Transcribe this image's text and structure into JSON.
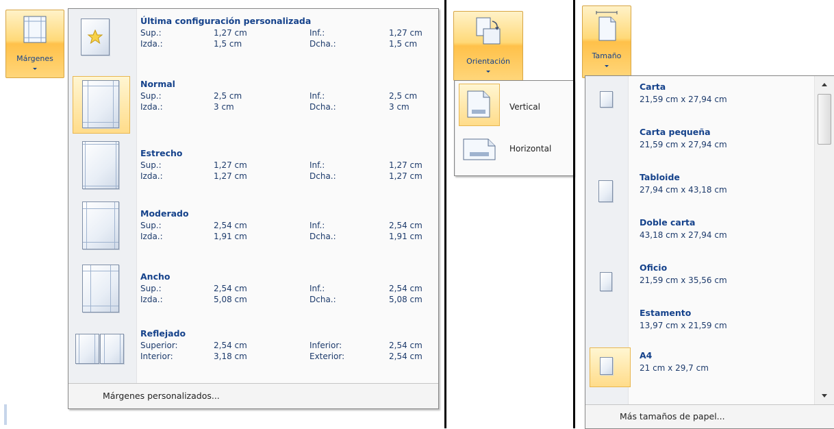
{
  "margins": {
    "button_label": "Márgenes",
    "items": [
      {
        "title": "Última configuración personalizada",
        "r1": [
          "Sup.:",
          "1,27 cm",
          "Inf.:",
          "1,27 cm"
        ],
        "r2": [
          "Izda.:",
          "1,5 cm",
          "Dcha.:",
          "1,5 cm"
        ]
      },
      {
        "title": "Normal",
        "r1": [
          "Sup.:",
          "2,5 cm",
          "Inf.:",
          "2,5 cm"
        ],
        "r2": [
          "Izda.:",
          "3 cm",
          "Dcha.:",
          "3 cm"
        ]
      },
      {
        "title": "Estrecho",
        "r1": [
          "Sup.:",
          "1,27 cm",
          "Inf.:",
          "1,27 cm"
        ],
        "r2": [
          "Izda.:",
          "1,27 cm",
          "Dcha.:",
          "1,27 cm"
        ]
      },
      {
        "title": "Moderado",
        "r1": [
          "Sup.:",
          "2,54 cm",
          "Inf.:",
          "2,54 cm"
        ],
        "r2": [
          "Izda.:",
          "1,91 cm",
          "Dcha.:",
          "1,91 cm"
        ]
      },
      {
        "title": "Ancho",
        "r1": [
          "Sup.:",
          "2,54 cm",
          "Inf.:",
          "2,54 cm"
        ],
        "r2": [
          "Izda.:",
          "5,08 cm",
          "Dcha.:",
          "5,08 cm"
        ]
      },
      {
        "title": "Reflejado",
        "r1": [
          "Superior:",
          "2,54 cm",
          "Inferior:",
          "2,54 cm"
        ],
        "r2": [
          "Interior:",
          "3,18 cm",
          "Exterior:",
          "2,54 cm"
        ]
      }
    ],
    "selected": "Normal",
    "footer": "Márgenes personalizados..."
  },
  "orientation": {
    "button_label": "Orientación",
    "items": [
      {
        "label": "Vertical",
        "icon": "portrait-page-icon"
      },
      {
        "label": "Horizontal",
        "icon": "landscape-page-icon"
      }
    ],
    "selected": "Vertical"
  },
  "size": {
    "button_label": "Tamaño",
    "items": [
      {
        "title": "Carta",
        "dims": "21,59 cm x 27,94 cm"
      },
      {
        "title": "Carta pequeña",
        "dims": "21,59 cm x 27,94 cm"
      },
      {
        "title": "Tabloide",
        "dims": "27,94 cm x 43,18 cm"
      },
      {
        "title": "Doble carta",
        "dims": "43,18 cm x 27,94 cm"
      },
      {
        "title": "Oficio",
        "dims": "21,59 cm x 35,56 cm"
      },
      {
        "title": "Estamento",
        "dims": "13,97 cm x 21,59 cm"
      },
      {
        "title": "A4",
        "dims": "21 cm x 29,7 cm"
      }
    ],
    "selected": "A4",
    "footer": "Más tamaños de papel..."
  },
  "colors": {
    "accent_title": "#15428b",
    "selected_bg": "#ffd67a",
    "selected_border": "#e8b650"
  }
}
